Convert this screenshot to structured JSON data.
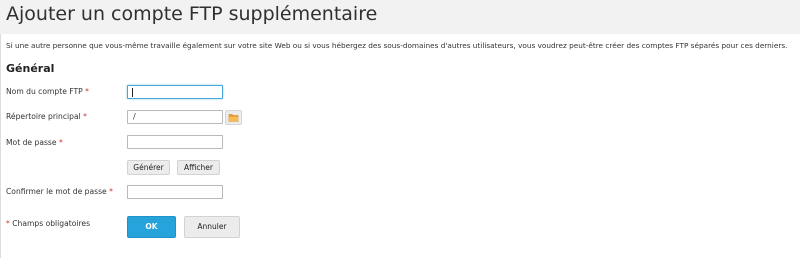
{
  "page": {
    "title": "Ajouter un compte FTP supplémentaire",
    "description": "Si une autre personne que vous-même travaille également sur votre site Web ou si vous hébergez des sous-domaines d'autres utilisateurs, vous voudrez peut-être créer des comptes FTP séparés pour ces derniers."
  },
  "section": {
    "title": "Général"
  },
  "form": {
    "required_mark": "*",
    "ftp_account_name": {
      "label": "Nom du compte FTP",
      "value": ""
    },
    "home_directory": {
      "label": "Répertoire principal",
      "value": "/"
    },
    "password": {
      "label": "Mot de passe",
      "value": ""
    },
    "generate_label": "Générer",
    "show_label": "Afficher",
    "confirm_password": {
      "label": "Confirmer le mot de passe",
      "value": ""
    },
    "required_note": "Champs obligatoires",
    "ok_label": "OK",
    "cancel_label": "Annuler"
  },
  "colors": {
    "accent": "#27a3db",
    "required": "#d02a2a",
    "folder_icon": "#f0a030"
  },
  "icons": {
    "browse": "folder-icon"
  }
}
